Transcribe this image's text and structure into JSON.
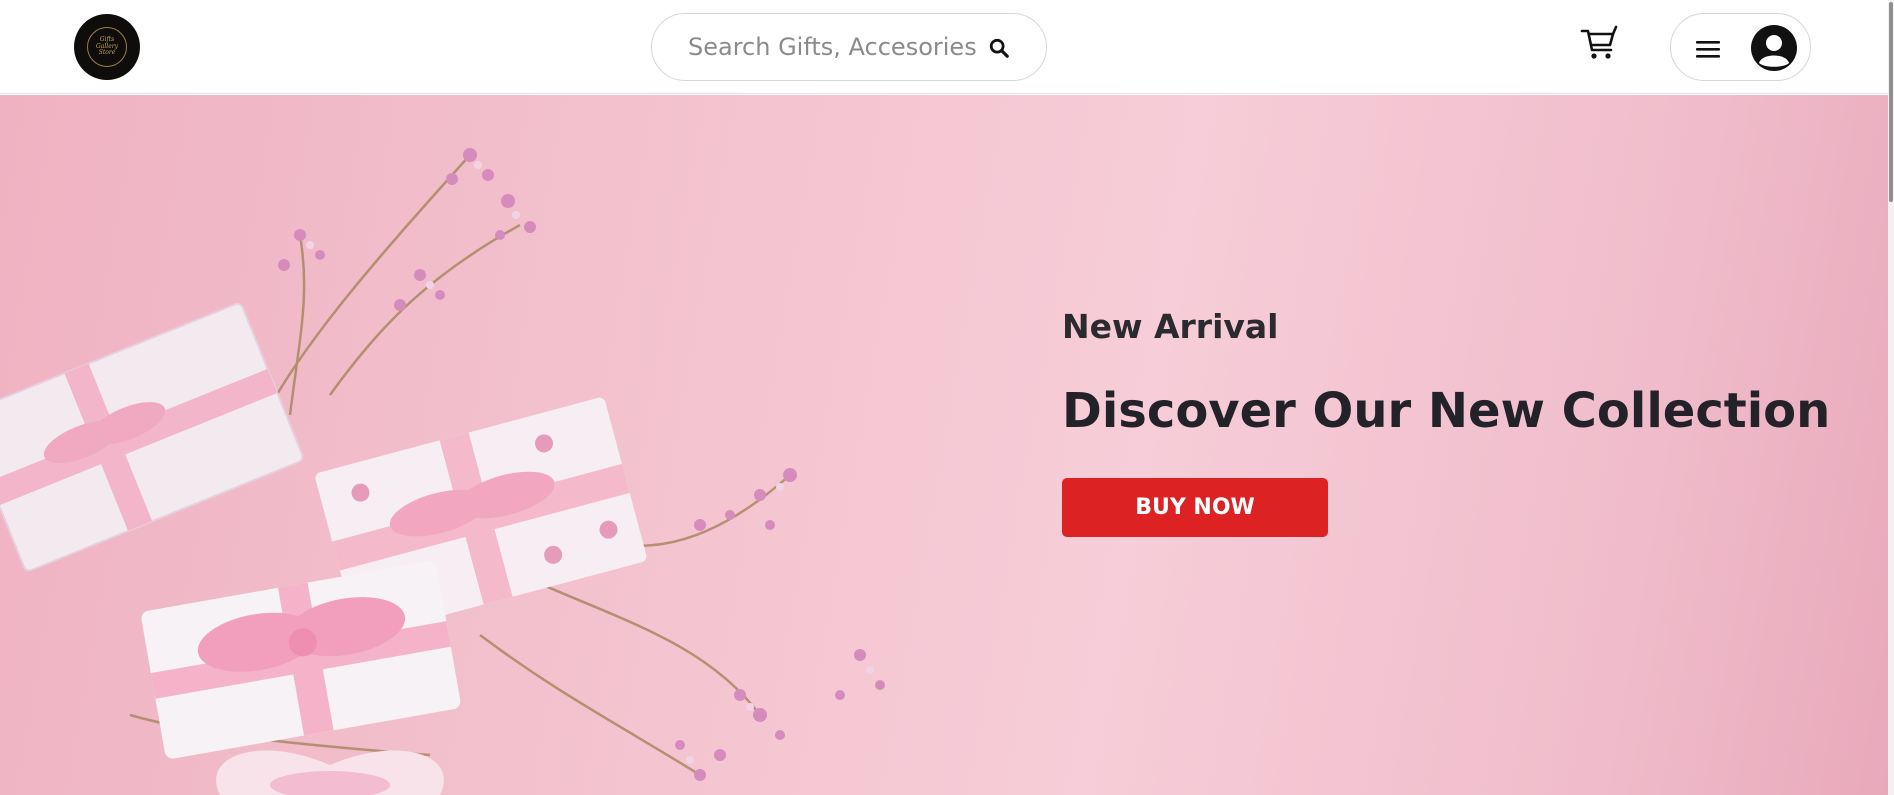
{
  "header": {
    "logo_text": "Gifts Gallery Store",
    "search": {
      "placeholder": "Search Gifts, Accesories",
      "value": "",
      "icon": "search-icon"
    },
    "cart_icon": "cart-icon",
    "menu_icon": "hamburger-menu-icon",
    "avatar_icon": "user-avatar-icon"
  },
  "hero": {
    "subtitle": "New Arrival",
    "title": "Discover Our New Collection",
    "cta_label": "BUY NOW"
  },
  "colors": {
    "accent": "#dd2224",
    "hero_background": "#f4c5d1",
    "text_dark": "#232229",
    "logo_background": "#0e0d0b"
  }
}
